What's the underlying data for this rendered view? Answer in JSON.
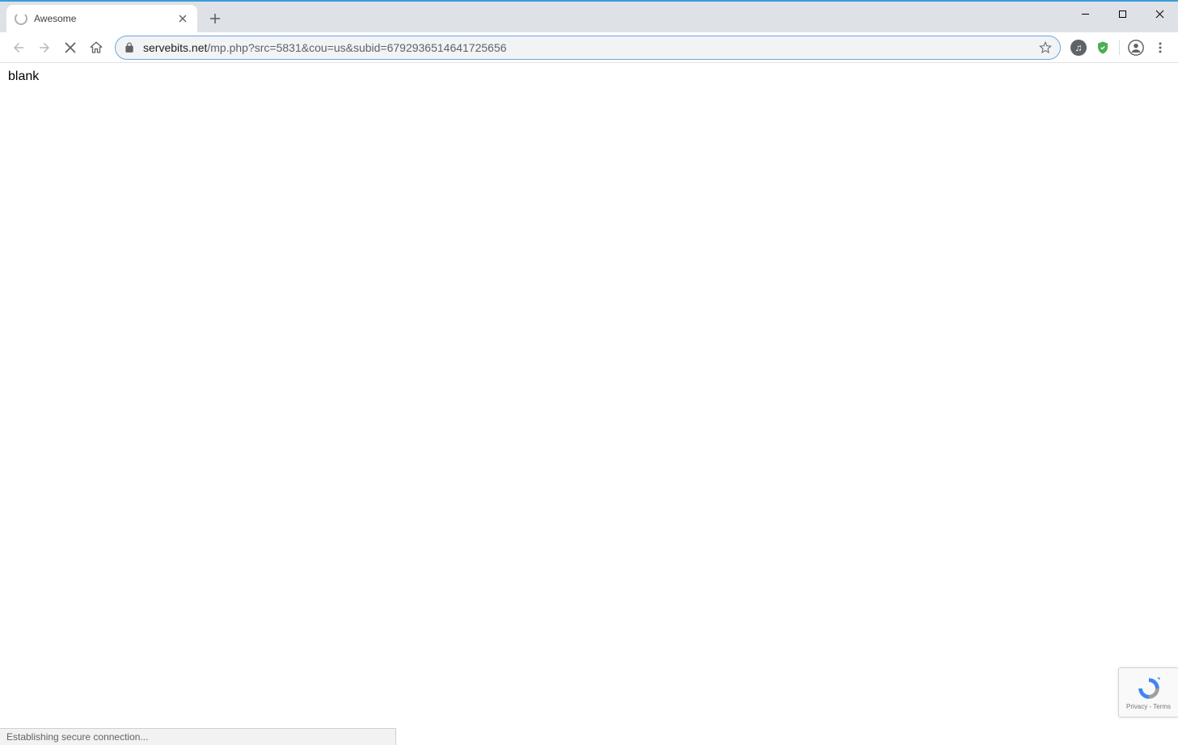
{
  "tab": {
    "title": "Awesome"
  },
  "url": {
    "domain": "servebits.net",
    "path": "/mp.php?src=5831&cou=us&subid=6792936514641725656"
  },
  "page": {
    "body_text": "blank"
  },
  "status_bar": {
    "text": "Establishing secure connection..."
  },
  "recaptcha": {
    "links": "Privacy - Terms"
  },
  "icons": {
    "close_glyph": "✕",
    "plus_glyph": "+",
    "music_glyph": "♫"
  }
}
